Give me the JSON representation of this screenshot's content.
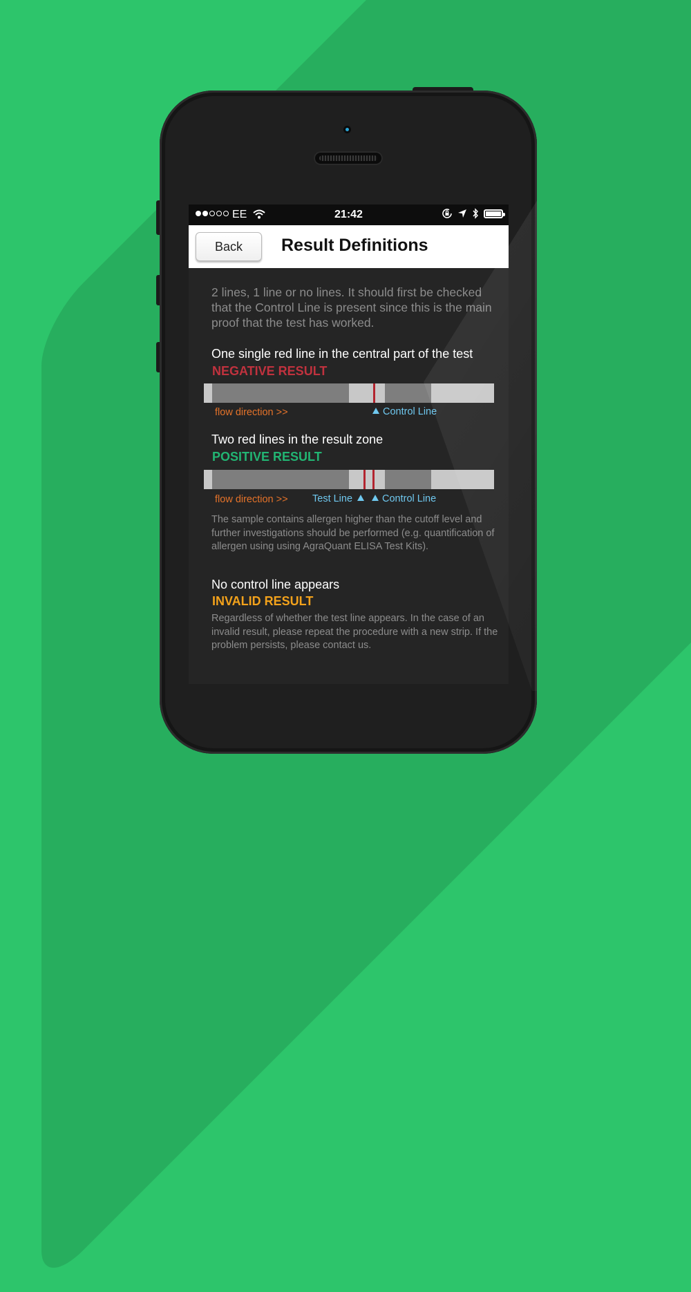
{
  "status_bar": {
    "carrier": "EE",
    "time": "21:42",
    "signal_bars_filled": 2,
    "signal_bars_total": 5
  },
  "nav": {
    "back_label": "Back",
    "title": "Result Definitions"
  },
  "content": {
    "intro": "2 lines, 1 line or no lines. It should first be checked that the Control Line is present since this is the main proof that the test has worked.",
    "negative": {
      "description": "One single red line in the central part of the test",
      "result": "NEGATIVE RESULT",
      "flow_label": "flow direction >>",
      "control_label": "Control Line"
    },
    "positive": {
      "description": "Two red lines in the result zone",
      "result": "POSITIVE RESULT",
      "flow_label": "flow direction >>",
      "test_label": "Test Line",
      "control_label": "Control Line",
      "note": "The sample contains allergen higher than the cutoff level and further investigations should be performed (e.g. quantification of allergen using using AgraQuant ELISA Test Kits)."
    },
    "invalid": {
      "description": "No control line appears",
      "result": "INVALID RESULT",
      "note": "Regardless of whether the test line appears. In the case of an invalid result, please repeat the procedure with a new strip. If the problem persists, please contact us."
    }
  },
  "colors": {
    "background": "#2dc56b",
    "negative": "#c0323e",
    "positive": "#22b573",
    "invalid": "#f3a21b",
    "flow": "#e5732a",
    "control": "#6fc8ef"
  }
}
